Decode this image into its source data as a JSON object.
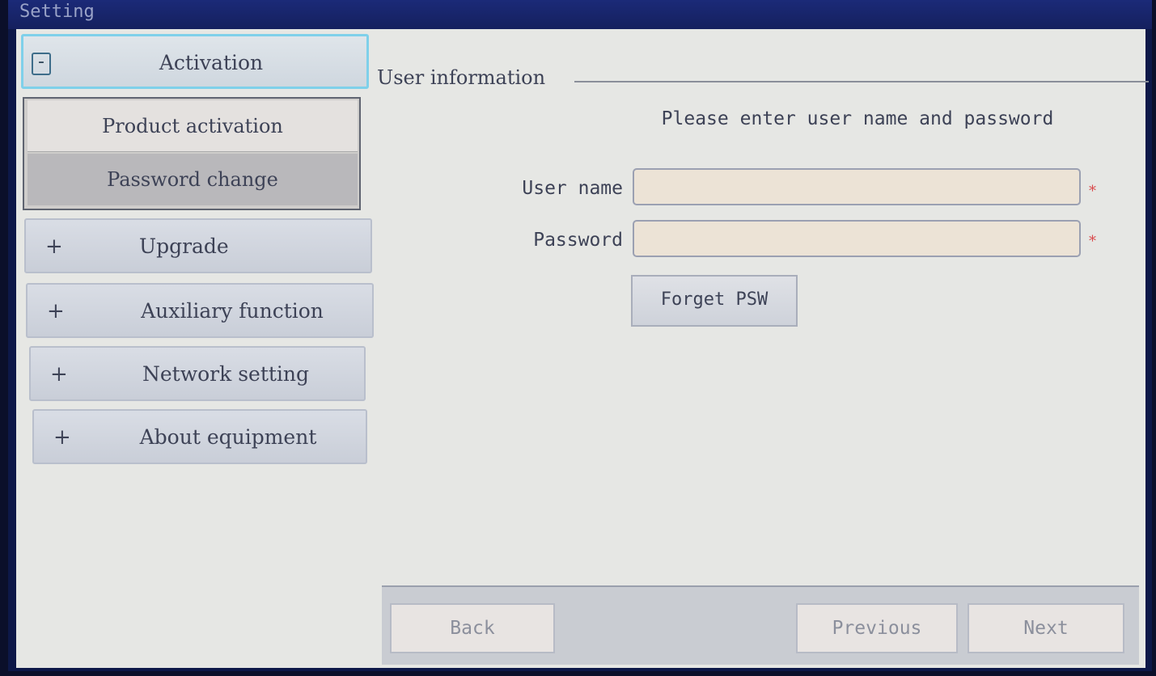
{
  "window": {
    "title": "Setting"
  },
  "sidebar": {
    "items": [
      {
        "sign": "-",
        "label": "Activation",
        "expanded": true
      },
      {
        "sign": "+",
        "label": "Upgrade"
      },
      {
        "sign": "+",
        "label": "Auxiliary function"
      },
      {
        "sign": "+",
        "label": "Network setting"
      },
      {
        "sign": "+",
        "label": "About equipment"
      }
    ],
    "sub_items": [
      {
        "label": "Product activation"
      },
      {
        "label": "Password change",
        "selected": true
      }
    ]
  },
  "main": {
    "group_title": "User information",
    "prompt": "Please enter user name and password",
    "username": {
      "label": "User name",
      "value": "",
      "required_mark": "*"
    },
    "password": {
      "label": "Password",
      "value": "",
      "required_mark": "*"
    },
    "forget_button": "Forget PSW"
  },
  "footer": {
    "back": "Back",
    "previous": "Previous",
    "next": "Next"
  }
}
